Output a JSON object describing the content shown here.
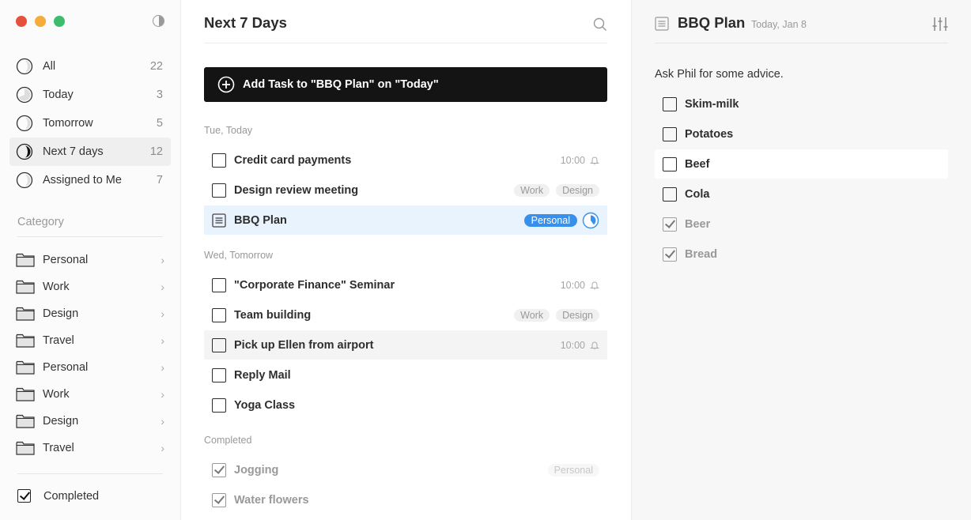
{
  "window": {
    "controls": [
      "close",
      "minimize",
      "zoom"
    ],
    "theme_toggle_icon": "contrast-icon"
  },
  "sidebar": {
    "smart_lists": [
      {
        "label": "All",
        "count": "22",
        "icon": "pie-progress-icon",
        "active": false
      },
      {
        "label": "Today",
        "count": "3",
        "icon": "pie-progress-icon",
        "active": false
      },
      {
        "label": "Tomorrow",
        "count": "5",
        "icon": "pie-progress-icon",
        "active": false
      },
      {
        "label": "Next 7 days",
        "count": "12",
        "icon": "pie-progress-icon",
        "active": true
      },
      {
        "label": "Assigned to Me",
        "count": "7",
        "icon": "pie-progress-icon",
        "active": false
      }
    ],
    "category_header": "Category",
    "categories": [
      {
        "label": "Personal",
        "icon": "folder-icon"
      },
      {
        "label": "Work",
        "icon": "folder-icon"
      },
      {
        "label": "Design",
        "icon": "folder-icon"
      },
      {
        "label": "Travel",
        "icon": "folder-icon"
      },
      {
        "label": "Personal",
        "icon": "folder-icon"
      },
      {
        "label": "Work",
        "icon": "folder-icon"
      },
      {
        "label": "Design",
        "icon": "folder-icon"
      },
      {
        "label": "Travel",
        "icon": "folder-icon"
      }
    ],
    "completed_toggle": {
      "label": "Completed",
      "checked": true
    }
  },
  "main": {
    "title": "Next 7 Days",
    "add_task_label": "Add Task to \"BBQ Plan\" on \"Today\"",
    "sections": [
      {
        "label": "Tue, Today",
        "tasks": [
          {
            "title": "Credit card payments",
            "time": "10:00",
            "reminder": true,
            "tags": []
          },
          {
            "title": "Design review meeting",
            "tags": [
              "Work",
              "Design"
            ]
          },
          {
            "title": "BBQ Plan",
            "type": "note",
            "selected": true,
            "tags": [
              "Personal"
            ],
            "progress": 0.4
          }
        ]
      },
      {
        "label": "Wed, Tomorrow",
        "tasks": [
          {
            "title": "\"Corporate Finance\" Seminar",
            "time": "10:00",
            "reminder": true,
            "tags": []
          },
          {
            "title": "Team building",
            "tags": [
              "Work",
              "Design"
            ]
          },
          {
            "title": "Pick up Ellen from airport",
            "time": "10:00",
            "reminder": true,
            "tags": []
          },
          {
            "title": "Reply Mail",
            "tags": []
          },
          {
            "title": "Yoga Class",
            "tags": []
          }
        ]
      },
      {
        "label": "Completed",
        "tasks": [
          {
            "title": "Jogging",
            "done": true,
            "tags": [
              "Personal"
            ]
          },
          {
            "title": "Water flowers",
            "done": true,
            "tags": []
          }
        ]
      }
    ]
  },
  "detail": {
    "title": "BBQ Plan",
    "date": "Today, Jan 8",
    "note": "Ask Phil for some advice.",
    "subtasks": [
      {
        "label": "Skim-milk",
        "done": false
      },
      {
        "label": "Potatoes",
        "done": false
      },
      {
        "label": "Beef",
        "done": false
      },
      {
        "label": "Cola",
        "done": false
      },
      {
        "label": "Beer",
        "done": true
      },
      {
        "label": "Bread",
        "done": true
      }
    ]
  },
  "colors": {
    "accent": "#3790ec",
    "add_task_bg": "#141414",
    "selected_row": "#e9f3fd",
    "close": "#e8503e",
    "minimize": "#f5ac3b",
    "zoom": "#3bbd6c"
  }
}
